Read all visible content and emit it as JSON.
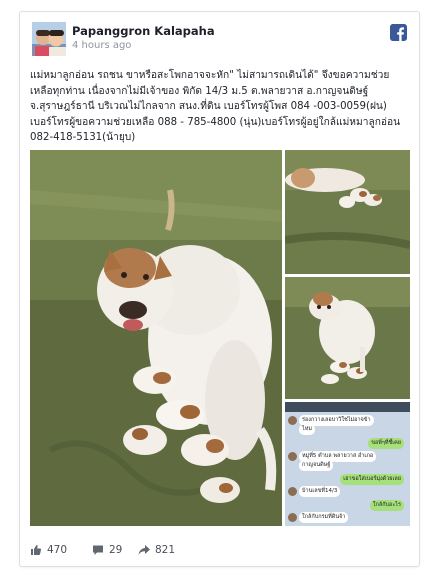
{
  "post": {
    "author": "Papanggron Kalapaha",
    "time": "4 hours ago",
    "text": "แม่หมาลูกอ่อน รถชน ขาหรือสะโพกอาจจะหัก\" ไม่สามารถเดินได้\" จึงขอความช่วยเหลือทุกท่าน เนื่องจากไม่มีเจ้าของ พิกัด 14/3 ม.5 ต.พลายวาส อ.กาญจนดิษฐ์ จ.สุราษฎร์ธานี บริเวณไม่ไกลจาก สนง.ที่ดิน เบอร์โทรผู้โพส 084 -003-0059(ฝน) เบอร์โทรผู้ขอความช่วยเหลือ 088 - 785-4800 (นุ่น)เบอร์โทรผู้อยู่ใกล้แม่หมาลูกอ่อน 082-418-5131(น้ายุบ)"
  },
  "chat": {
    "messages": [
      {
        "dir": "in",
        "text": "ร่องกวางเลอบาวิใช่ไม่อาจข้า"
      },
      {
        "dir": "in",
        "text": "ไหม"
      },
      {
        "dir": "out",
        "text": "ขอพี่ๆที่ชี้เคย"
      },
      {
        "dir": "in",
        "text": "หมู่ที่5 ตำบล พลายวาส อำเภอ"
      },
      {
        "dir": "in",
        "text": "กาญจนดิษฐ์"
      },
      {
        "dir": "out",
        "text": "เฮาขอใส่เบอร์มุ่งด้วยเลย"
      },
      {
        "dir": "in",
        "text": "บ้านเลขที่14/3"
      },
      {
        "dir": "out",
        "text": "ใกล้กับอะไร"
      },
      {
        "dir": "in",
        "text": "ใกล้กับกรมที่ดินจ้า"
      }
    ]
  },
  "stats": {
    "likes": "470",
    "comments": "29",
    "shares": "821"
  },
  "icons": {
    "brand": "facebook-icon",
    "like": "thumbs-up-icon",
    "comment": "comment-bubble-icon",
    "share": "share-arrow-icon"
  },
  "colors": {
    "facebook_blue": "#3b5998",
    "meta_gray": "#90949c",
    "footer_gray": "#4b4f56"
  }
}
